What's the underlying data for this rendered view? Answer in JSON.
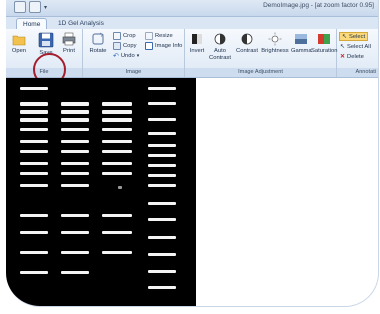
{
  "window": {
    "title": "DemoImage.jpg - [at zoom factor 0.95]"
  },
  "tabs": [
    {
      "label": "Home"
    },
    {
      "label": "1D Gel Analysis"
    }
  ],
  "ribbon": {
    "file": {
      "label": "File",
      "open": "Open",
      "save": "Save",
      "print": "Print"
    },
    "image": {
      "label": "Image",
      "rotate": "Rotate",
      "crop": "Crop",
      "resize": "Resize",
      "copy": "Copy",
      "undo": "Undo",
      "image_info": "Image Info"
    },
    "adjust": {
      "label": "Image Adjustment",
      "invert": "Invert",
      "auto_contrast_1": "Auto",
      "auto_contrast_2": "Contrast",
      "contrast": "Contrast",
      "brightness": "Brightness",
      "gamma": "Gamma",
      "saturation": "Saturation"
    },
    "annotation": {
      "label": "Annotati",
      "select": "Select",
      "select_all": "Select All",
      "delete": "Delete"
    }
  },
  "colors": {
    "accent_ring": "#a31f2e",
    "ribbon_bg": "#dde8f5",
    "gel_bg": "#000000",
    "band": "#f4f4f4"
  },
  "icons": [
    "open-folder-icon",
    "save-floppy-icon",
    "print-icon",
    "rotate-icon",
    "crop-icon",
    "copy-icon",
    "undo-icon",
    "image-info-icon",
    "invert-icon",
    "contrast-icon",
    "brightness-icon",
    "gamma-icon",
    "saturation-icon",
    "select-icon",
    "delete-icon"
  ]
}
